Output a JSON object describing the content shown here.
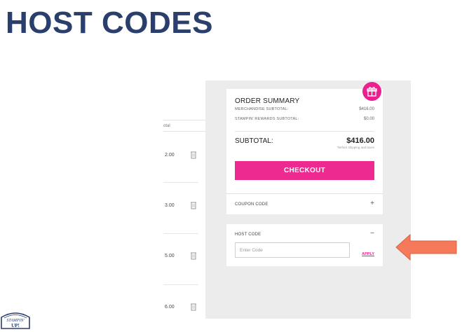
{
  "slide": {
    "title": "HOST CODES"
  },
  "cart": {
    "header_fragment": "otal",
    "rows": [
      {
        "price": "2.00"
      },
      {
        "price": "3.00"
      },
      {
        "price": "5.00"
      },
      {
        "price": "6.00"
      }
    ]
  },
  "summary": {
    "title": "ORDER SUMMARY",
    "merch_label": "MERCHANDISE SUBTOTAL:",
    "merch_value": "$416.00",
    "rewards_label": "STAMPIN' REWARDS SUBTOTAL:",
    "rewards_value": "$0.00",
    "subtotal_label": "SUBTOTAL:",
    "subtotal_value": "$416.00",
    "subtotal_note": "*before shipping and taxes",
    "checkout_label": "CHECKOUT",
    "gift_icon": "gift-icon"
  },
  "coupon": {
    "label": "COUPON CODE",
    "toggle": "+"
  },
  "host": {
    "label": "HOST CODE",
    "toggle": "−",
    "placeholder": "Enter Code",
    "apply_label": "APPLY"
  },
  "colors": {
    "title": "#2b3f6c",
    "accent": "#ec2a8f",
    "arrow": "#f47a5b",
    "panel_bg": "#ececec"
  },
  "logo": {
    "text": "STAMPIN' UP!"
  }
}
